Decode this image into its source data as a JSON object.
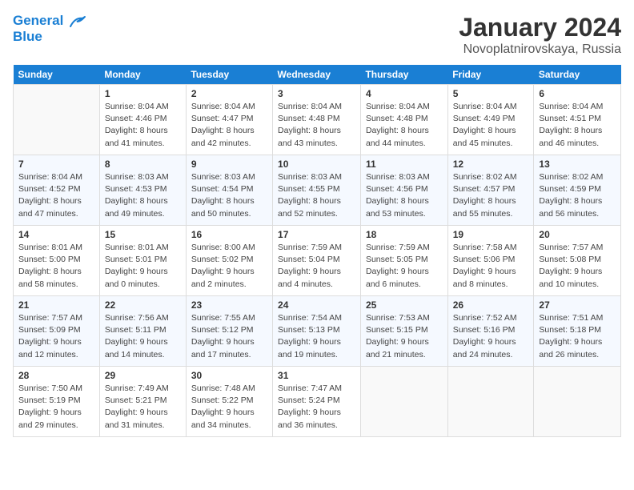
{
  "header": {
    "logo_line1": "General",
    "logo_line2": "Blue",
    "month": "January 2024",
    "location": "Novoplatnirovskaya, Russia"
  },
  "weekdays": [
    "Sunday",
    "Monday",
    "Tuesday",
    "Wednesday",
    "Thursday",
    "Friday",
    "Saturday"
  ],
  "weeks": [
    [
      {
        "day": "",
        "sunrise": "",
        "sunset": "",
        "daylight": ""
      },
      {
        "day": "1",
        "sunrise": "Sunrise: 8:04 AM",
        "sunset": "Sunset: 4:46 PM",
        "daylight": "Daylight: 8 hours and 41 minutes."
      },
      {
        "day": "2",
        "sunrise": "Sunrise: 8:04 AM",
        "sunset": "Sunset: 4:47 PM",
        "daylight": "Daylight: 8 hours and 42 minutes."
      },
      {
        "day": "3",
        "sunrise": "Sunrise: 8:04 AM",
        "sunset": "Sunset: 4:48 PM",
        "daylight": "Daylight: 8 hours and 43 minutes."
      },
      {
        "day": "4",
        "sunrise": "Sunrise: 8:04 AM",
        "sunset": "Sunset: 4:48 PM",
        "daylight": "Daylight: 8 hours and 44 minutes."
      },
      {
        "day": "5",
        "sunrise": "Sunrise: 8:04 AM",
        "sunset": "Sunset: 4:49 PM",
        "daylight": "Daylight: 8 hours and 45 minutes."
      },
      {
        "day": "6",
        "sunrise": "Sunrise: 8:04 AM",
        "sunset": "Sunset: 4:51 PM",
        "daylight": "Daylight: 8 hours and 46 minutes."
      }
    ],
    [
      {
        "day": "7",
        "sunrise": "Sunrise: 8:04 AM",
        "sunset": "Sunset: 4:52 PM",
        "daylight": "Daylight: 8 hours and 47 minutes."
      },
      {
        "day": "8",
        "sunrise": "Sunrise: 8:03 AM",
        "sunset": "Sunset: 4:53 PM",
        "daylight": "Daylight: 8 hours and 49 minutes."
      },
      {
        "day": "9",
        "sunrise": "Sunrise: 8:03 AM",
        "sunset": "Sunset: 4:54 PM",
        "daylight": "Daylight: 8 hours and 50 minutes."
      },
      {
        "day": "10",
        "sunrise": "Sunrise: 8:03 AM",
        "sunset": "Sunset: 4:55 PM",
        "daylight": "Daylight: 8 hours and 52 minutes."
      },
      {
        "day": "11",
        "sunrise": "Sunrise: 8:03 AM",
        "sunset": "Sunset: 4:56 PM",
        "daylight": "Daylight: 8 hours and 53 minutes."
      },
      {
        "day": "12",
        "sunrise": "Sunrise: 8:02 AM",
        "sunset": "Sunset: 4:57 PM",
        "daylight": "Daylight: 8 hours and 55 minutes."
      },
      {
        "day": "13",
        "sunrise": "Sunrise: 8:02 AM",
        "sunset": "Sunset: 4:59 PM",
        "daylight": "Daylight: 8 hours and 56 minutes."
      }
    ],
    [
      {
        "day": "14",
        "sunrise": "Sunrise: 8:01 AM",
        "sunset": "Sunset: 5:00 PM",
        "daylight": "Daylight: 8 hours and 58 minutes."
      },
      {
        "day": "15",
        "sunrise": "Sunrise: 8:01 AM",
        "sunset": "Sunset: 5:01 PM",
        "daylight": "Daylight: 9 hours and 0 minutes."
      },
      {
        "day": "16",
        "sunrise": "Sunrise: 8:00 AM",
        "sunset": "Sunset: 5:02 PM",
        "daylight": "Daylight: 9 hours and 2 minutes."
      },
      {
        "day": "17",
        "sunrise": "Sunrise: 7:59 AM",
        "sunset": "Sunset: 5:04 PM",
        "daylight": "Daylight: 9 hours and 4 minutes."
      },
      {
        "day": "18",
        "sunrise": "Sunrise: 7:59 AM",
        "sunset": "Sunset: 5:05 PM",
        "daylight": "Daylight: 9 hours and 6 minutes."
      },
      {
        "day": "19",
        "sunrise": "Sunrise: 7:58 AM",
        "sunset": "Sunset: 5:06 PM",
        "daylight": "Daylight: 9 hours and 8 minutes."
      },
      {
        "day": "20",
        "sunrise": "Sunrise: 7:57 AM",
        "sunset": "Sunset: 5:08 PM",
        "daylight": "Daylight: 9 hours and 10 minutes."
      }
    ],
    [
      {
        "day": "21",
        "sunrise": "Sunrise: 7:57 AM",
        "sunset": "Sunset: 5:09 PM",
        "daylight": "Daylight: 9 hours and 12 minutes."
      },
      {
        "day": "22",
        "sunrise": "Sunrise: 7:56 AM",
        "sunset": "Sunset: 5:11 PM",
        "daylight": "Daylight: 9 hours and 14 minutes."
      },
      {
        "day": "23",
        "sunrise": "Sunrise: 7:55 AM",
        "sunset": "Sunset: 5:12 PM",
        "daylight": "Daylight: 9 hours and 17 minutes."
      },
      {
        "day": "24",
        "sunrise": "Sunrise: 7:54 AM",
        "sunset": "Sunset: 5:13 PM",
        "daylight": "Daylight: 9 hours and 19 minutes."
      },
      {
        "day": "25",
        "sunrise": "Sunrise: 7:53 AM",
        "sunset": "Sunset: 5:15 PM",
        "daylight": "Daylight: 9 hours and 21 minutes."
      },
      {
        "day": "26",
        "sunrise": "Sunrise: 7:52 AM",
        "sunset": "Sunset: 5:16 PM",
        "daylight": "Daylight: 9 hours and 24 minutes."
      },
      {
        "day": "27",
        "sunrise": "Sunrise: 7:51 AM",
        "sunset": "Sunset: 5:18 PM",
        "daylight": "Daylight: 9 hours and 26 minutes."
      }
    ],
    [
      {
        "day": "28",
        "sunrise": "Sunrise: 7:50 AM",
        "sunset": "Sunset: 5:19 PM",
        "daylight": "Daylight: 9 hours and 29 minutes."
      },
      {
        "day": "29",
        "sunrise": "Sunrise: 7:49 AM",
        "sunset": "Sunset: 5:21 PM",
        "daylight": "Daylight: 9 hours and 31 minutes."
      },
      {
        "day": "30",
        "sunrise": "Sunrise: 7:48 AM",
        "sunset": "Sunset: 5:22 PM",
        "daylight": "Daylight: 9 hours and 34 minutes."
      },
      {
        "day": "31",
        "sunrise": "Sunrise: 7:47 AM",
        "sunset": "Sunset: 5:24 PM",
        "daylight": "Daylight: 9 hours and 36 minutes."
      },
      {
        "day": "",
        "sunrise": "",
        "sunset": "",
        "daylight": ""
      },
      {
        "day": "",
        "sunrise": "",
        "sunset": "",
        "daylight": ""
      },
      {
        "day": "",
        "sunrise": "",
        "sunset": "",
        "daylight": ""
      }
    ]
  ]
}
